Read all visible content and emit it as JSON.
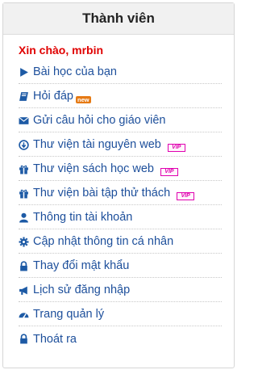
{
  "panel": {
    "title": "Thành viên",
    "greeting": "Xin chào, mrbin"
  },
  "menu": {
    "items": [
      {
        "label": "Bài học của bạn",
        "icon": "play-icon"
      },
      {
        "label": "Hỏi đáp",
        "icon": "book-icon",
        "badge": "new"
      },
      {
        "label": "Gửi câu hỏi cho giáo viên",
        "icon": "envelope-icon"
      },
      {
        "label": "Thư viện tài nguyên web",
        "icon": "download-icon",
        "badge": "VIP"
      },
      {
        "label": "Thư viện sách học web",
        "icon": "gift-icon",
        "badge": "VIP"
      },
      {
        "label": "Thư viện bài tập thử thách",
        "icon": "gift-icon",
        "badge": "VIP"
      },
      {
        "label": "Thông tin tài khoản",
        "icon": "user-icon"
      },
      {
        "label": "Cập nhật thông tin cá nhân",
        "icon": "gear-icon"
      },
      {
        "label": "Thay đổi mật khẩu",
        "icon": "lock-icon"
      },
      {
        "label": "Lịch sử đăng nhập",
        "icon": "bullhorn-icon"
      },
      {
        "label": "Trang quản lý",
        "icon": "dashboard-icon"
      },
      {
        "label": "Thoát ra",
        "icon": "lock-icon"
      }
    ]
  },
  "colors": {
    "link": "#1d4f9b",
    "greeting": "#e00000",
    "new_badge": "#e67a14",
    "vip_badge": "#e000b0"
  }
}
